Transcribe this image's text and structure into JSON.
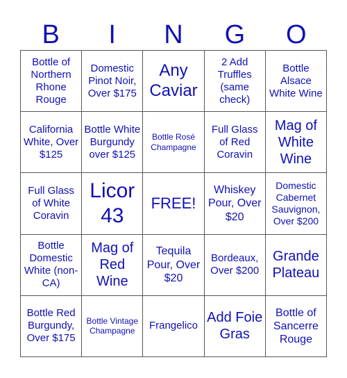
{
  "header": {
    "letters": [
      "B",
      "I",
      "N",
      "G",
      "O"
    ]
  },
  "board": {
    "cells": [
      "Bottle of Northern Rhone Rouge",
      "Domestic Pinot Noir, Over $175",
      "Any Caviar",
      "2 Add Truffles (same check)",
      "Bottle Alsace White Wine",
      "California White, Over $125",
      "Bottle White Burgundy over $125",
      "Bottle Rosé Champagne",
      "Full Glass of Red Coravin",
      "Mag of White Wine",
      "Full Glass of White Coravin",
      "Licor 43",
      "FREE!",
      "Whiskey Pour, Over $20",
      "Domestic Cabernet Sauvignon, Over $200",
      "Bottle Domestic White (non-CA)",
      "Mag of Red Wine",
      "Tequila Pour, Over $20",
      "Bordeaux, Over $200",
      "Grande Plateau",
      "Bottle Red Burgundy, Over $175",
      "Bottle Vintage Champagne",
      "Frangelico",
      "Add Foie Gras",
      "Bottle of Sancerre Rouge"
    ]
  },
  "colors": {
    "text": "#1010b4",
    "grid_line": "#555555"
  }
}
